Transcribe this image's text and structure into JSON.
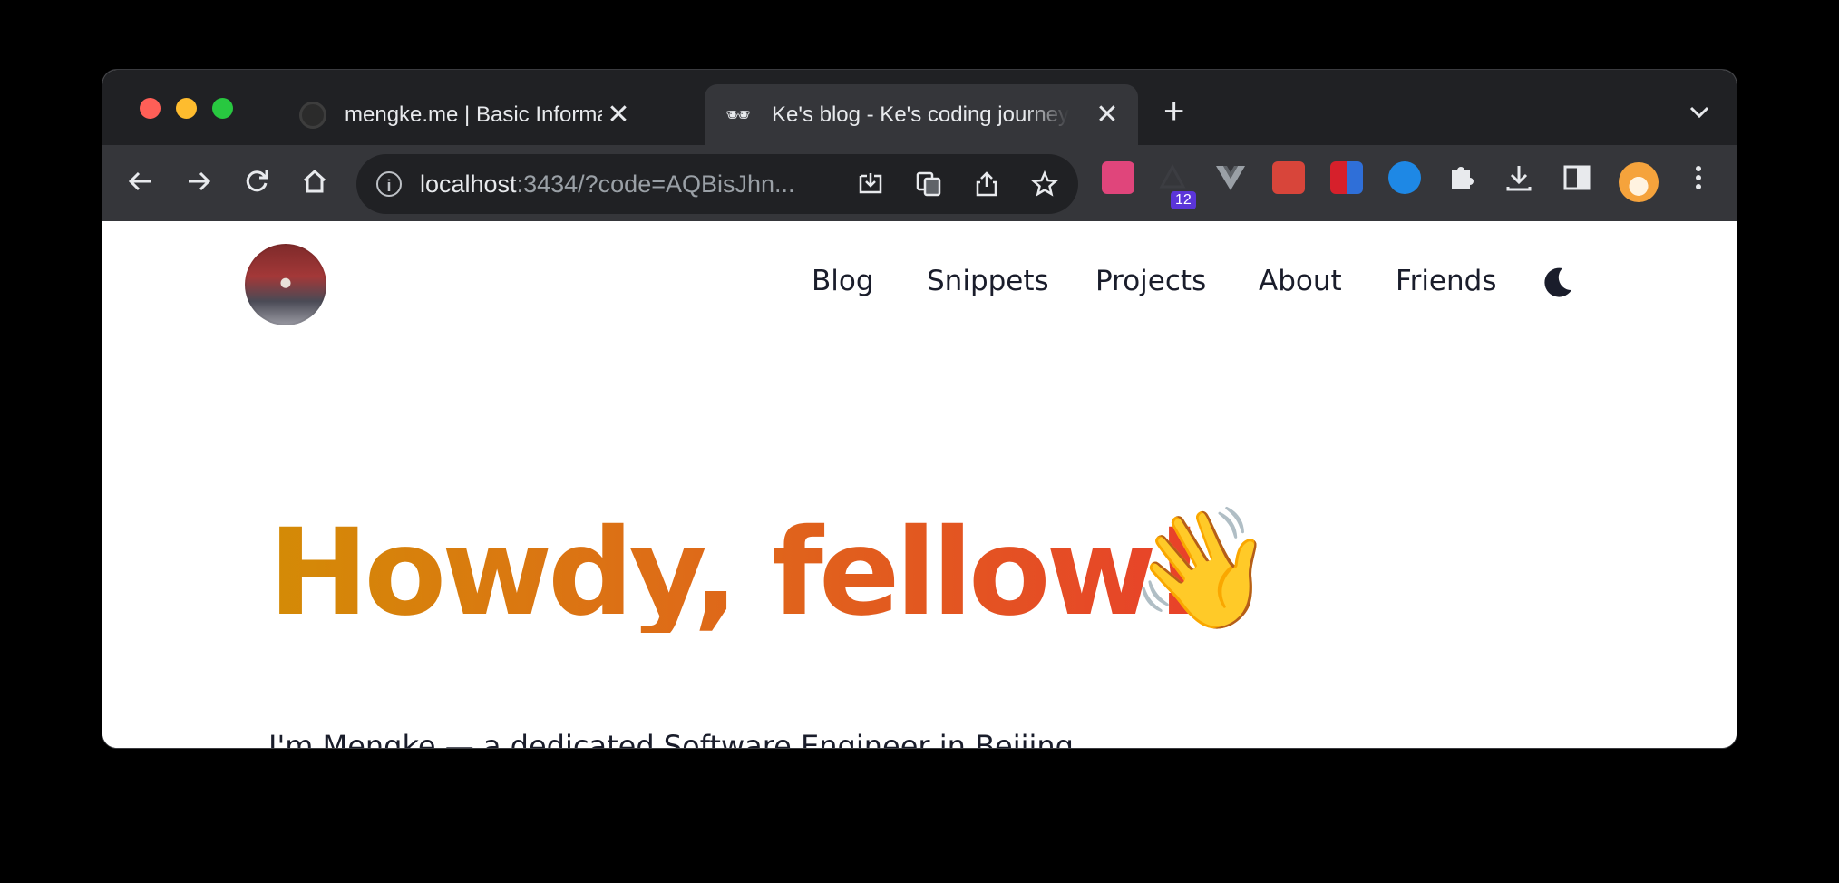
{
  "browser": {
    "tabs": [
      {
        "title": "mengke.me | Basic Information",
        "active": false
      },
      {
        "title": "Ke's blog - Ke's coding journey",
        "favicon": "🕶",
        "active": true
      }
    ],
    "address": {
      "host": "localhost",
      "rest": ":3434/?code=AQBisJhn..."
    },
    "extension_badge": "12",
    "icons": {
      "back": "arrow-left-icon",
      "forward": "arrow-right-icon",
      "reload": "reload-icon",
      "home": "home-icon",
      "info": "info-icon",
      "install": "install-app-icon",
      "translate": "translate-icon",
      "share": "share-icon",
      "bookmark": "star-icon",
      "extensions": "puzzle-icon",
      "downloads": "download-icon",
      "sidepanel": "side-panel-icon",
      "menu": "kebab-menu-icon"
    },
    "info_glyph": "i",
    "new_tab_glyph": "+",
    "close_glyph": "✕",
    "tab_search_glyph": "⌄"
  },
  "site": {
    "nav": [
      "Blog",
      "Snippets",
      "Projects",
      "About",
      "Friends"
    ],
    "hero": {
      "title": "Howdy, fellow!",
      "emoji": "👋"
    },
    "intro": "I'm Mengke — a dedicated Software Engineer in Beijing"
  },
  "colors": {
    "hero_gradient_start": "#d48b06",
    "hero_gradient_end": "#e8412a",
    "nav_text": "#1a1d2b",
    "chrome_dark": "#202124",
    "chrome_toolbar": "#35363a"
  }
}
